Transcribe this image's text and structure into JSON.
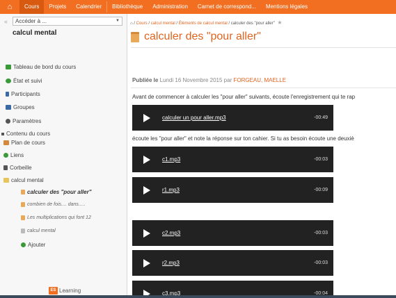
{
  "nav": {
    "items": [
      {
        "label": "Cours",
        "active": true
      },
      {
        "label": "Projets"
      },
      {
        "label": "Calendrier"
      },
      {
        "label": "Bibliothèque"
      },
      {
        "label": "Administration"
      },
      {
        "label": "Carnet de correspond..."
      },
      {
        "label": "Mentions légales"
      }
    ],
    "accent": "#f26f21"
  },
  "sidebar": {
    "goto_label": "Accéder à ...",
    "course_title": "calcul mental",
    "items": [
      {
        "label": "Tableau de bord du cours",
        "icon": "dashboard-icon",
        "color": "#3a9a3a"
      },
      {
        "label": "État et suivi",
        "icon": "progress-icon",
        "color": "#3a9a3a"
      },
      {
        "label": "Participants",
        "icon": "participants-icon",
        "color": "#3a6aa5"
      },
      {
        "label": "Groupes",
        "icon": "groups-icon",
        "color": "#3a6aa5"
      },
      {
        "label": "Paramètres",
        "icon": "settings-icon",
        "color": "#555555"
      },
      {
        "label": "Contenu du cours",
        "icon": "content-icon",
        "color": "#555555"
      },
      {
        "label": "Plan de cours",
        "icon": "syllabus-icon",
        "color": "#d48a3a"
      },
      {
        "label": "Liens",
        "icon": "links-icon",
        "color": "#3a9a3a"
      },
      {
        "label": "Corbeille",
        "icon": "trash-icon",
        "color": "#555555"
      },
      {
        "label": "calcul mental",
        "icon": "folder-icon",
        "color": "#e8c45a"
      }
    ],
    "subitems": [
      {
        "label": "calculer des \"pour aller\"",
        "current": true
      },
      {
        "label": "combien de fois.... dans....."
      },
      {
        "label": "Les multiplications qui font 12"
      },
      {
        "label": "calcul mental"
      }
    ],
    "add_label": "Ajouter",
    "learning_label": "Learning",
    "learning_logo": "ES"
  },
  "breadcrumb": {
    "home_icon": "home-icon",
    "items": [
      "Cours",
      "calcul mental",
      "Éléments de calcul mental",
      "calculer des \"pour aller\""
    ]
  },
  "page": {
    "title": "calculer des \"pour aller\"",
    "published_prefix": "Publiée le",
    "published_date": "Lundi 16 Novembre 2015",
    "published_by": "par",
    "author": "FORGEAU, MAELLE",
    "para1": "Avant de commencer à calculer les \"pour aller\" suivants, écoute l'enregistrement qui te rap",
    "para2": "écoute les \"pour aller\" et note la réponse sur ton cahier. Si tu as besoin écoute une deuxiè"
  },
  "players": [
    {
      "file": "calculer un pour aller.mp3",
      "duration": "-00:49"
    },
    {
      "file": "c1.mp3",
      "duration": "-00:03"
    },
    {
      "file": "r1.mp3",
      "duration": "-00:09"
    },
    {
      "file": "c2.mp3",
      "duration": "-00:03"
    },
    {
      "file": "r2.mp3",
      "duration": "-00:03"
    },
    {
      "file": "c3.mp3",
      "duration": "-00:04"
    }
  ]
}
